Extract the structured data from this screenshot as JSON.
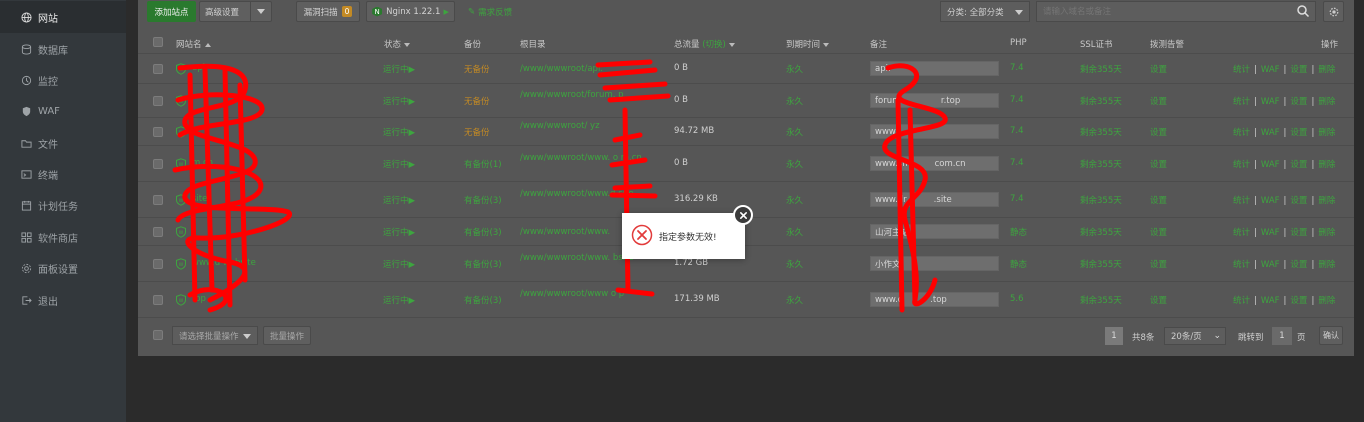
{
  "sidebar": {
    "items": [
      {
        "label": "网站",
        "icon": "globe-icon",
        "active": true
      },
      {
        "label": "数据库",
        "icon": "database-icon"
      },
      {
        "label": "监控",
        "icon": "monitor-icon"
      },
      {
        "label": "WAF",
        "icon": "shield-icon"
      },
      {
        "label": "文件",
        "icon": "folder-icon"
      },
      {
        "label": "终端",
        "icon": "terminal-icon"
      },
      {
        "label": "计划任务",
        "icon": "calendar-icon"
      },
      {
        "label": "软件商店",
        "icon": "apps-icon"
      },
      {
        "label": "面板设置",
        "icon": "gear-icon"
      },
      {
        "label": "退出",
        "icon": "logout-icon"
      }
    ]
  },
  "toolbar": {
    "add_site": "添加站点",
    "advanced": "高级设置",
    "vuln_scan": "漏洞扫描",
    "vuln_count": "0",
    "nginx": "Nginx 1.22.1",
    "feedback": "需求反馈",
    "category": "分类: 全部分类",
    "search_placeholder": "请输入域名或备注"
  },
  "table": {
    "headers": {
      "name": "网站名",
      "status": "状态",
      "backup": "备份",
      "root": "根目录",
      "traffic": "总流量",
      "traffic_switch": "(切换)",
      "expire": "到期时间",
      "note": "备注",
      "php": "PHP",
      "ssl": "SSL证书",
      "alert": "拨测告警",
      "ops": "操作"
    },
    "rows": [
      {
        "name": "api.",
        "status": "运行中▶",
        "backup": "无备份",
        "backup_type": "none",
        "root": "/www/wwwroot/api.",
        "traffic": "0 B",
        "expire": "永久",
        "note": "api.",
        "php": "7.4",
        "ssl": "剩余355天",
        "alert": "设置"
      },
      {
        "name": "",
        "status": "运行中▶",
        "backup": "无备份",
        "backup_type": "none",
        "root": "/www/wwwroot/forum.                    p",
        "traffic": "0 B",
        "expire": "永久",
        "note": "forum.              r.top",
        "php": "7.4",
        "ssl": "剩余355天",
        "alert": "设置"
      },
      {
        "name": "",
        "status": "运行中▶",
        "backup": "无备份",
        "backup_type": "none",
        "root": "/www/wwwroot/              yz",
        "traffic": "94.72 MB",
        "expire": "永久",
        "note": "www.",
        "php": "7.4",
        "ssl": "剩余355天",
        "alert": "设置"
      },
      {
        "name": "m.cn",
        "status": "运行中▶",
        "backup": "有备份(1)",
        "backup_type": "has",
        "root": "/www/wwwroot/www.                 o m.cn",
        "traffic": "0 B",
        "expire": "永久",
        "note": "www.sh          com.cn",
        "php": "7.4",
        "ssl": "剩余355天",
        "alert": "设置"
      },
      {
        "name": "site",
        "status": "运行中▶",
        "backup": "有备份(3)",
        "backup_type": "has",
        "root": "/www/wwwroot/www.d                 site",
        "traffic": "316.29 KB",
        "expire": "永久",
        "note": "www.dr          .site",
        "php": "7.4",
        "ssl": "剩余355天",
        "alert": "设置"
      },
      {
        "name": "",
        "status": "运行中▶",
        "backup": "有备份(3)",
        "backup_type": "has",
        "root": "/www/wwwroot/www.",
        "traffic": "",
        "expire": "永久",
        "note": "山河主站",
        "php": "静态",
        "ssl": "剩余355天",
        "alert": "设置"
      },
      {
        "name": "www.d          website",
        "status": "运行中▶",
        "backup": "有备份(3)",
        "backup_type": "has",
        "root": "/www/wwwroot/www.              bsite",
        "traffic": "1.72 GB",
        "expire": "永久",
        "note": "小作文",
        "php": "静态",
        "ssl": "剩余355天",
        "alert": "设置"
      },
      {
        "name": "top",
        "status": "运行中▶",
        "backup": "有备份(3)",
        "backup_type": "has",
        "root": "/www/wwwroot/www               o p",
        "traffic": "171.39 MB",
        "expire": "永久",
        "note": "www.d          .top",
        "php": "5.6",
        "ssl": "剩余355天",
        "alert": "设置"
      }
    ],
    "ops": [
      "统计",
      "WAF",
      "设置",
      "删除"
    ]
  },
  "footer": {
    "batch_placeholder": "请选择批量操作",
    "batch_button": "批量操作",
    "page_current": "1",
    "total": "共8条",
    "per_page": "20条/页",
    "jump_label": "跳转到",
    "jump_value": "1",
    "page_unit": "页",
    "confirm": "确认"
  },
  "dialog": {
    "message": "指定参数无效!"
  },
  "colors": {
    "accent": "#2a7a2e",
    "link": "#3da53f",
    "warning": "#c38a24",
    "error": "#e23b3b"
  }
}
